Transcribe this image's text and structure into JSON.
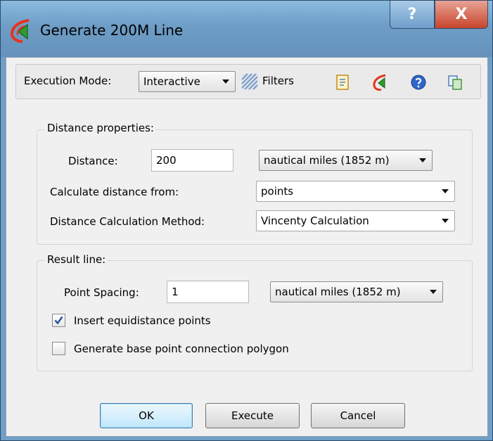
{
  "window": {
    "title": "Generate 200M Line",
    "help_label": "?",
    "close_label": "X"
  },
  "toolbar": {
    "execution_mode_label": "Execution Mode:",
    "execution_mode_value": "Interactive",
    "filters_label": "Filters"
  },
  "distance_group": {
    "title": "Distance properties:",
    "distance_label": "Distance:",
    "distance_value": "200",
    "distance_unit": "nautical miles (1852 m)",
    "calc_from_label": "Calculate distance from:",
    "calc_from_value": "points",
    "method_label": "Distance Calculation Method:",
    "method_value": "Vincenty Calculation"
  },
  "result_group": {
    "title": "Result line:",
    "spacing_label": "Point Spacing:",
    "spacing_value": "1",
    "spacing_unit": "nautical miles (1852 m)",
    "equidistance_label": "Insert equidistance points",
    "equidistance_checked": true,
    "polygon_label": "Generate base point connection polygon",
    "polygon_checked": false
  },
  "buttons": {
    "ok": "OK",
    "execute": "Execute",
    "cancel": "Cancel"
  },
  "colors": {
    "title_bar": "#6f9fc7",
    "close_button": "#c8442c",
    "default_button_border": "#3c7fb1",
    "check_mark": "#1f4fa0"
  },
  "icons": [
    "app-logo-icon",
    "filters-icon",
    "notes-icon",
    "app-logo-icon",
    "help-icon",
    "copy-icon",
    "check-icon"
  ]
}
